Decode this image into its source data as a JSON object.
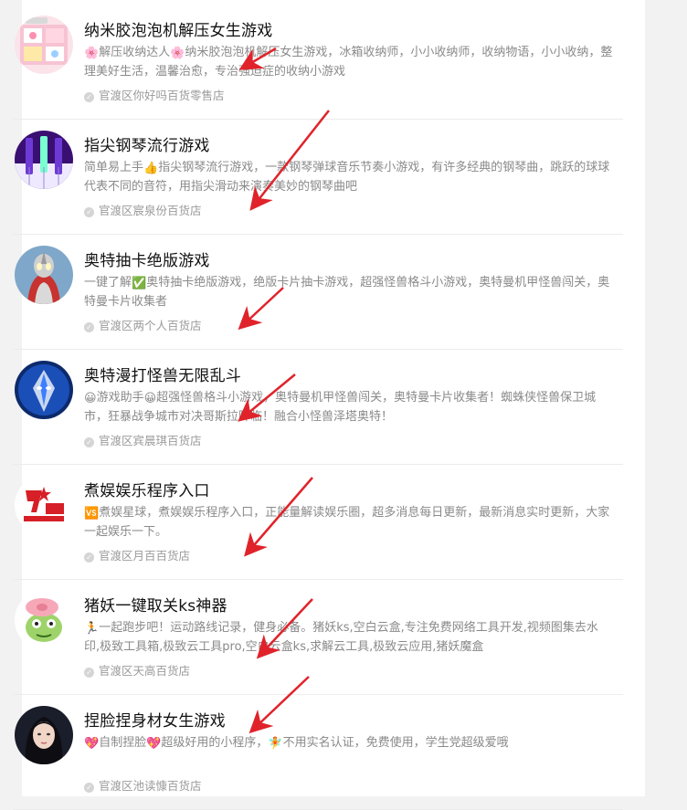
{
  "items": [
    {
      "title": "纳米胶泡泡机解压女生游戏",
      "desc_segments": [
        {
          "emoji": "🌸",
          "text": "解压收纳达人"
        },
        {
          "emoji": "🌸",
          "text": "纳米胶泡泡机解压女生游戏，冰箱收纳师，小小收纳师，收纳物语，小小收纳，整理美好生活，温馨治愈，专治强迫症的收纳小游戏"
        }
      ],
      "shop": "官渡区你好吗百货零售店",
      "avatar_icon": "storage-game-avatar"
    },
    {
      "title": "指尖钢琴流行游戏",
      "desc_segments": [
        {
          "emoji": "",
          "text": "简单易上手"
        },
        {
          "emoji": "👍",
          "text": "指尖钢琴流行游戏，一款钢琴弹球音乐节奏小游戏，有许多经典的钢琴曲，跳跃的球球代表不同的音符，用指尖滑动来演奏美妙的钢琴曲吧"
        }
      ],
      "shop": "官渡区宸泉份百货店",
      "avatar_icon": "piano-game-avatar"
    },
    {
      "title": "奥特抽卡绝版游戏",
      "desc_segments": [
        {
          "emoji": "",
          "text": "一键了解"
        },
        {
          "emoji": "✅",
          "text": "奥特抽卡绝版游戏，绝版卡片抽卡游戏，超强怪兽格斗小游戏，奥特曼机甲怪兽闯关，奥特曼卡片收集者"
        }
      ],
      "shop": "官渡区两个人百货店",
      "avatar_icon": "ultraman-avatar"
    },
    {
      "title": "奥特漫打怪兽无限乱斗",
      "desc_segments": [
        {
          "emoji": "😀",
          "text": "游戏助手"
        },
        {
          "emoji": "😀",
          "text": "超强怪兽格斗小游戏，奥特曼机甲怪兽闯关，奥特曼卡片收集者！蜘蛛侠怪兽保卫城市，狂暴战争城市对决哥斯拉降临！融合小怪兽泽塔奥特！"
        }
      ],
      "shop": "官渡区宾晨琪百货店",
      "avatar_icon": "hero-avatar"
    },
    {
      "title": "煮娱娱乐程序入口",
      "desc_segments": [
        {
          "emoji": "🆚",
          "text": "煮娱星球，煮娱娱乐程序入口，正能量解读娱乐圈，超多消息每日更新，最新消息实时更新，大家一起娱乐一下。"
        }
      ],
      "shop": "官渡区月百百货店",
      "avatar_icon": "power-star-logo"
    },
    {
      "title": "猪妖一键取关ks神器",
      "desc_segments": [
        {
          "emoji": "🏃",
          "text": "一起跑步吧！运动路线记录，健身必备。猪妖ks,空白云盒,专注免费网络工具开发,视频图集去水印,极致工具箱,极致云工具pro,空白云盒ks,求解云工具,极致云应用,猪妖魔盒"
        }
      ],
      "shop": "官渡区天高百货店",
      "avatar_icon": "pig-monster-avatar"
    },
    {
      "title": "捏脸捏身材女生游戏",
      "desc_segments": [
        {
          "emoji": "💖",
          "text": "自制捏脸"
        },
        {
          "emoji": "💖",
          "text": "超级好用的小程序，"
        },
        {
          "emoji": "🧚",
          "text": "不用实名认证，免费使用，学生党超级爱哦"
        }
      ],
      "shop": "官渡区池读慷百货店",
      "avatar_icon": "girl-portrait-avatar"
    }
  ],
  "colors": {
    "arrow": "#e0232b",
    "title": "#111111",
    "desc": "#8a8a8a",
    "shop": "#9a9a9a"
  }
}
